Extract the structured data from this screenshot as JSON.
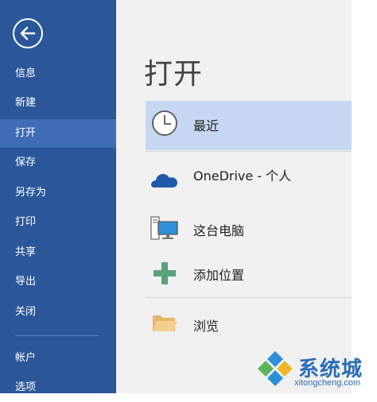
{
  "sidebar": {
    "back_icon": "back-arrow-icon",
    "items": [
      {
        "label": "信息"
      },
      {
        "label": "新建"
      },
      {
        "label": "打开"
      },
      {
        "label": "保存"
      },
      {
        "label": "另存为"
      },
      {
        "label": "打印"
      },
      {
        "label": "共享"
      },
      {
        "label": "导出"
      },
      {
        "label": "关闭"
      },
      {
        "label": "帐户"
      },
      {
        "label": "选项"
      }
    ],
    "bg_color": "#2b579a",
    "active_color": "#3e6db5"
  },
  "main": {
    "title": "打开",
    "locations": [
      {
        "label": "最近",
        "icon": "clock-icon"
      },
      {
        "label": "OneDrive - 个人",
        "icon": "cloud-icon"
      },
      {
        "label": "这台电脑",
        "icon": "computer-icon"
      },
      {
        "label": "添加位置",
        "icon": "plus-icon"
      },
      {
        "label": "浏览",
        "icon": "folder-icon"
      }
    ],
    "selected_color": "#c5d7f1"
  },
  "watermark": {
    "title": "系统城",
    "url": "xitongcheng.com"
  }
}
